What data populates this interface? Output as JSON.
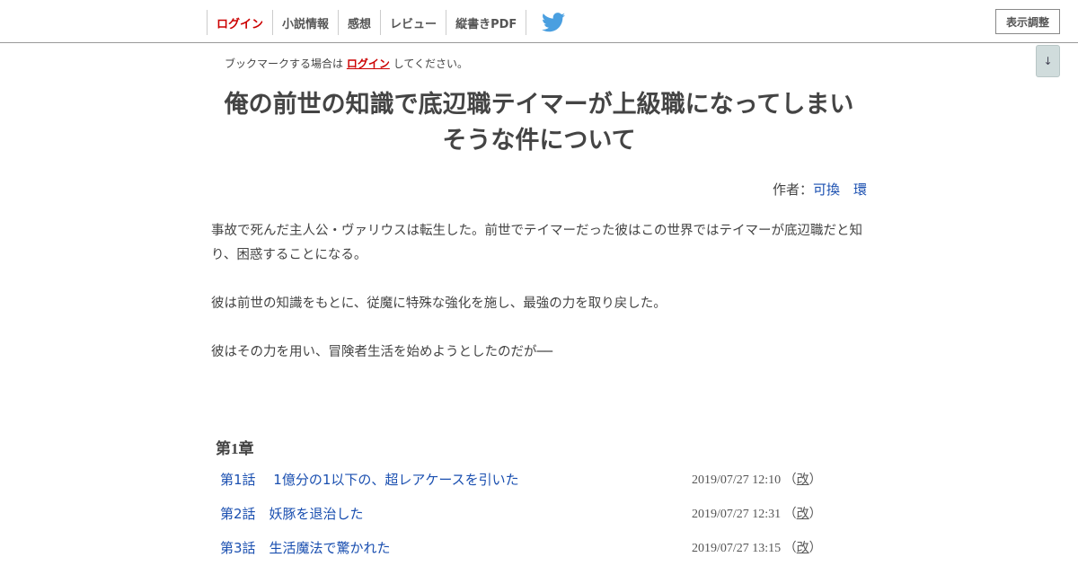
{
  "nav": {
    "items": [
      {
        "label": "ログイン"
      },
      {
        "label": "小説情報"
      },
      {
        "label": "感想"
      },
      {
        "label": "レビュー"
      },
      {
        "label": "縦書きPDF"
      }
    ],
    "twitter_icon": "twitter-bird-icon",
    "display_settings_label": "表示調整",
    "scroll_down_label": "↓"
  },
  "bookmark": {
    "prefix": "ブックマークする場合は",
    "link": "ログイン",
    "suffix": "してください。"
  },
  "novel": {
    "title_line1": "俺の前世の知識で底辺職テイマーが上級職になってしまい",
    "title_line2": "そうな件について",
    "author_label": "作者：",
    "author_name": "可換　環"
  },
  "synopsis": [
    "事故で死んだ主人公・ヴァリウスは転生した。前世でテイマーだった彼はこの世界ではテイマーが底辺職だと知り、困惑することになる。",
    "彼は前世の知識をもとに、従魔に特殊な強化を施し、最強の力を取り戻した。",
    "彼はその力を用い、冒険者生活を始めようとしたのだが──"
  ],
  "chapter": {
    "title": "第1章",
    "episodes": [
      {
        "title": "第1話　 1億分の1以下の、超レアケースを引いた",
        "date": "2019/07/27 12:10",
        "revised_open": "（",
        "revised": "改",
        "revised_close": "）"
      },
      {
        "title": "第2話　妖豚を退治した",
        "date": "2019/07/27 12:31",
        "revised_open": "（",
        "revised": "改",
        "revised_close": "）"
      },
      {
        "title": "第3話　生活魔法で驚かれた",
        "date": "2019/07/27 13:15",
        "revised_open": "（",
        "revised": "改",
        "revised_close": "）"
      }
    ]
  },
  "colors": {
    "accent_red": "#cc0000",
    "link_blue": "#1a4fb0",
    "twitter_blue": "#4a9fe0"
  }
}
